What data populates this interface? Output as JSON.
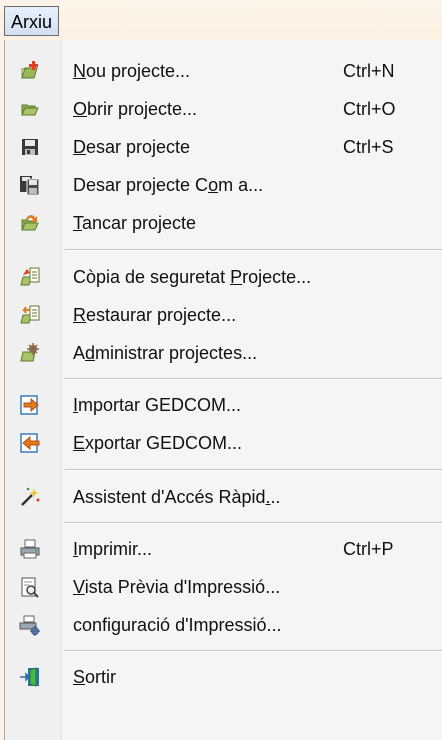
{
  "menu": {
    "title": "Arxiu"
  },
  "items": [
    {
      "id": "new-project",
      "pre": "",
      "key": "N",
      "post": "ou projecte...",
      "shortcut": "Ctrl+N",
      "icon": "new-project-icon"
    },
    {
      "id": "open-project",
      "pre": "",
      "key": "O",
      "post": "brir projecte...",
      "shortcut": "Ctrl+O",
      "icon": "open-folder-icon"
    },
    {
      "id": "save-project",
      "pre": "",
      "key": "D",
      "post": "esar projecte",
      "shortcut": "Ctrl+S",
      "icon": "floppy-disk-icon"
    },
    {
      "id": "save-project-as",
      "pre": "Desar projecte C",
      "key": "o",
      "post": "m a...",
      "shortcut": "",
      "icon": "save-as-icon"
    },
    {
      "id": "close-project",
      "pre": "",
      "key": "T",
      "post": "ancar projecte",
      "shortcut": "",
      "icon": "close-project-icon"
    },
    {
      "id": "backup-project",
      "pre": "Còpia de seguretat ",
      "key": "P",
      "post": "rojecte...",
      "shortcut": "",
      "icon": "backup-icon"
    },
    {
      "id": "restore-project",
      "pre": "",
      "key": "R",
      "post": "estaurar projecte...",
      "shortcut": "",
      "icon": "restore-icon"
    },
    {
      "id": "manage-projects",
      "pre": "A",
      "key": "d",
      "post": "ministrar projectes...",
      "shortcut": "",
      "icon": "manage-projects-icon"
    },
    {
      "id": "import-gedcom",
      "pre": "",
      "key": "I",
      "post": "mportar GEDCOM...",
      "shortcut": "",
      "icon": "import-icon"
    },
    {
      "id": "export-gedcom",
      "pre": "",
      "key": "E",
      "post": "xportar GEDCOM...",
      "shortcut": "",
      "icon": "export-icon"
    },
    {
      "id": "quick-access-wizard",
      "pre": "Assistent d'Accés Ràpid",
      "key": ".",
      "post": "..",
      "shortcut": "",
      "icon": "magic-wand-icon"
    },
    {
      "id": "print",
      "pre": "",
      "key": "I",
      "post": "mprimir...",
      "shortcut": "Ctrl+P",
      "icon": "printer-icon"
    },
    {
      "id": "print-preview",
      "pre": "",
      "key": "V",
      "post": "ista Prèvia d'Impressió...",
      "shortcut": "",
      "icon": "print-preview-icon"
    },
    {
      "id": "print-setup",
      "pre": "confi",
      "key": "g",
      "post": "uració d'Impressió...",
      "shortcut": "",
      "icon": "print-setup-icon"
    },
    {
      "id": "exit",
      "pre": "",
      "key": "S",
      "post": "ortir",
      "shortcut": "",
      "icon": "exit-door-icon"
    }
  ]
}
